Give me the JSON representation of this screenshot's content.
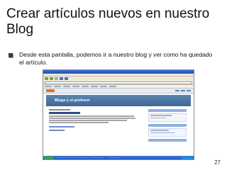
{
  "slide": {
    "title": "Crear artículos nuevos en nuestro Blog",
    "bullet": "Desde esta pantalla, podemos ir a nuestro blog y ver como ha quedado el artículo.",
    "page_number": "27"
  },
  "screenshot": {
    "blog_title": "Blogs y el profesor"
  }
}
